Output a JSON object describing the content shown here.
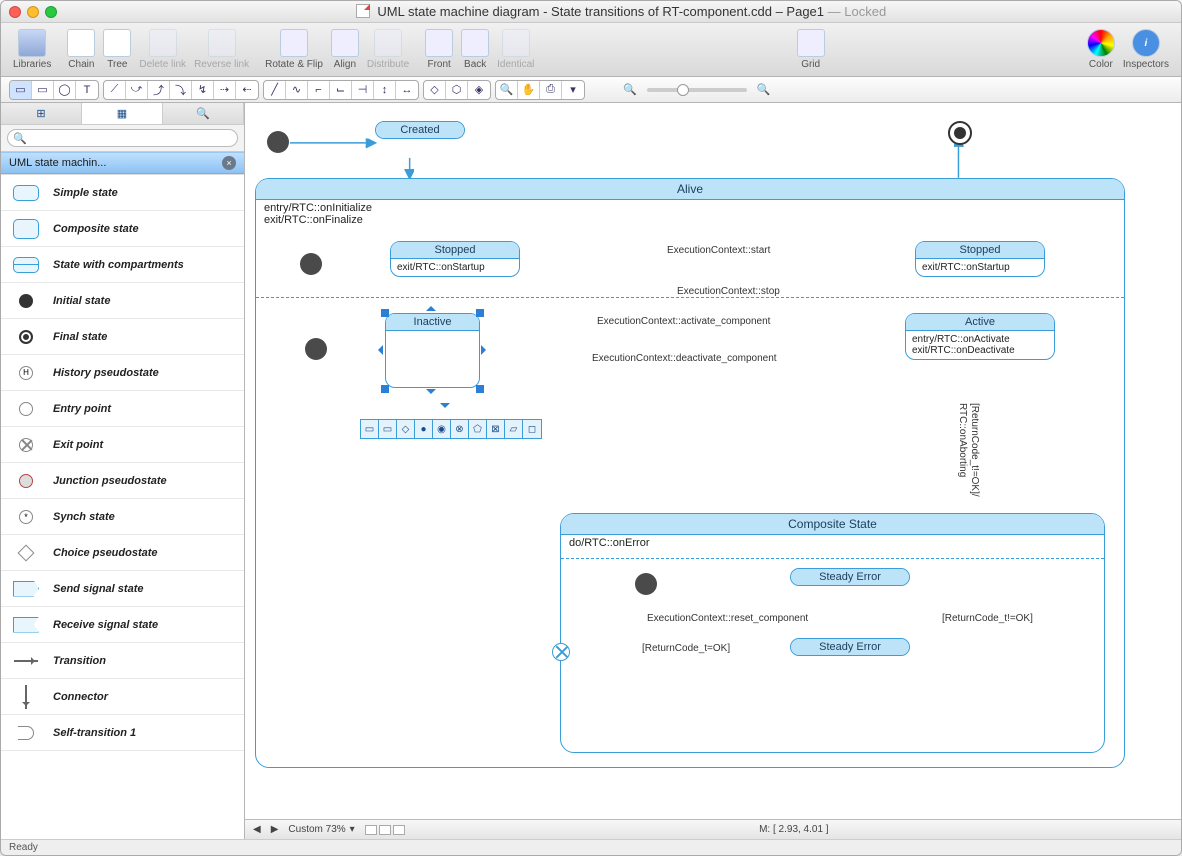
{
  "title": {
    "filename": "UML state machine diagram - State transitions of RT-component.cdd",
    "page": "Page1",
    "locked": "Locked"
  },
  "toolbar": {
    "libraries": "Libraries",
    "chain": "Chain",
    "tree": "Tree",
    "delete_link": "Delete link",
    "reverse_link": "Reverse link",
    "rotate_flip": "Rotate & Flip",
    "align": "Align",
    "distribute": "Distribute",
    "front": "Front",
    "back": "Back",
    "identical": "Identical",
    "grid": "Grid",
    "color": "Color",
    "inspectors": "Inspectors"
  },
  "sidebar": {
    "library_name": "UML state machin...",
    "items": [
      "Simple state",
      "Composite state",
      "State with compartments",
      "Initial state",
      "Final state",
      "History pseudostate",
      "Entry point",
      "Exit point",
      "Junction pseudostate",
      "Synch state",
      "Choice pseudostate",
      "Send signal state",
      "Receive signal state",
      "Transition",
      "Connector",
      "Self-transition 1"
    ]
  },
  "diagram": {
    "created": "Created",
    "alive": "Alive",
    "alive_entry": "entry/RTC::onInitialize",
    "alive_exit": "exit/RTC::onFinalize",
    "stopped": "Stopped",
    "stopped_body": "exit/RTC::onStartup",
    "inactive": "Inactive",
    "active": "Active",
    "active_entry": "entry/RTC::onActivate",
    "active_exit": "exit/RTC::onDeactivate",
    "composite": "Composite State",
    "composite_body": "do/RTC::onError",
    "steady_error": "Steady Error",
    "ec_start": "ExecutionContext::start",
    "ec_stop": "ExecutionContext::stop",
    "ec_activate": "ExecutionContext::activate_component",
    "ec_deactivate": "ExecutionContext::deactivate_component",
    "ec_reset": "ExecutionContext::reset_component",
    "guard_not_ok": "[ReturnCode_t!=OK]/",
    "guard_aborting": "RTC::onAborting",
    "guard_ok": "[ReturnCode_t=OK]",
    "guard_ok2": "[ReturnCode_t!=OK]"
  },
  "status": {
    "zoom": "Custom 73%",
    "coords_label": "M:",
    "coords": "[ 2.93, 4.01 ]",
    "ready": "Ready"
  }
}
